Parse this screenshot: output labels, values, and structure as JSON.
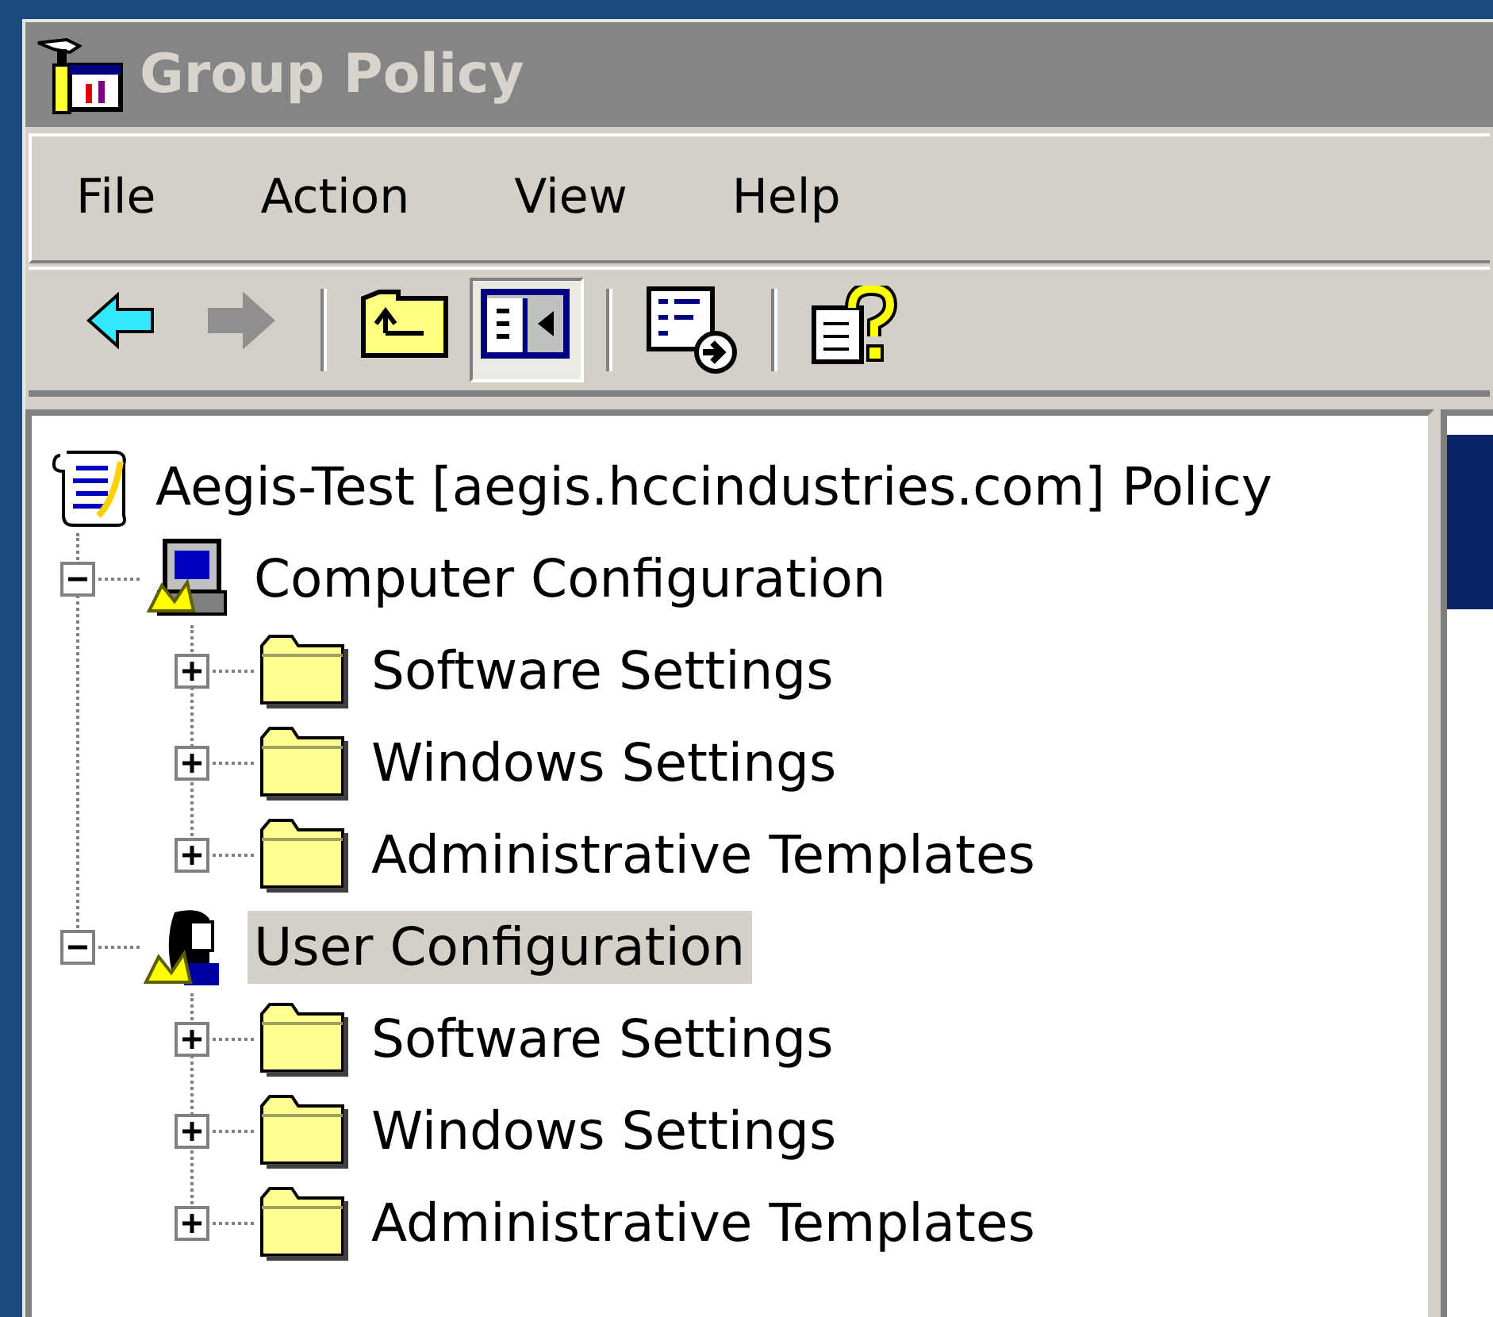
{
  "window": {
    "title": "Group Policy"
  },
  "menu": [
    "File",
    "Action",
    "View",
    "Help"
  ],
  "toolbar": [
    {
      "kind": "back",
      "disabled": false,
      "pressed": false
    },
    {
      "kind": "forward",
      "disabled": true,
      "pressed": false
    },
    {
      "kind": "separator"
    },
    {
      "kind": "up",
      "disabled": false,
      "pressed": false
    },
    {
      "kind": "tree",
      "disabled": false,
      "pressed": true
    },
    {
      "kind": "separator"
    },
    {
      "kind": "export",
      "disabled": false,
      "pressed": false
    },
    {
      "kind": "separator"
    },
    {
      "kind": "help",
      "disabled": false,
      "pressed": false
    }
  ],
  "tree": {
    "label": "Aegis-Test [aegis.hccindustries.com] Policy",
    "kind": "policy",
    "selected": false,
    "children": [
      {
        "label": "Computer Configuration",
        "kind": "computer",
        "expanded": true,
        "selected": false,
        "children": [
          {
            "label": "Software Settings",
            "kind": "folder",
            "expanded": false,
            "selected": false
          },
          {
            "label": "Windows Settings",
            "kind": "folder",
            "expanded": false,
            "selected": false
          },
          {
            "label": "Administrative Templates",
            "kind": "folder",
            "expanded": false,
            "selected": false
          }
        ]
      },
      {
        "label": "User Configuration",
        "kind": "user",
        "expanded": true,
        "selected": true,
        "children": [
          {
            "label": "Software Settings",
            "kind": "folder",
            "expanded": false,
            "selected": false
          },
          {
            "label": "Windows Settings",
            "kind": "folder",
            "expanded": false,
            "selected": false
          },
          {
            "label": "Administrative Templates",
            "kind": "folder",
            "expanded": false,
            "selected": false
          }
        ]
      }
    ]
  }
}
